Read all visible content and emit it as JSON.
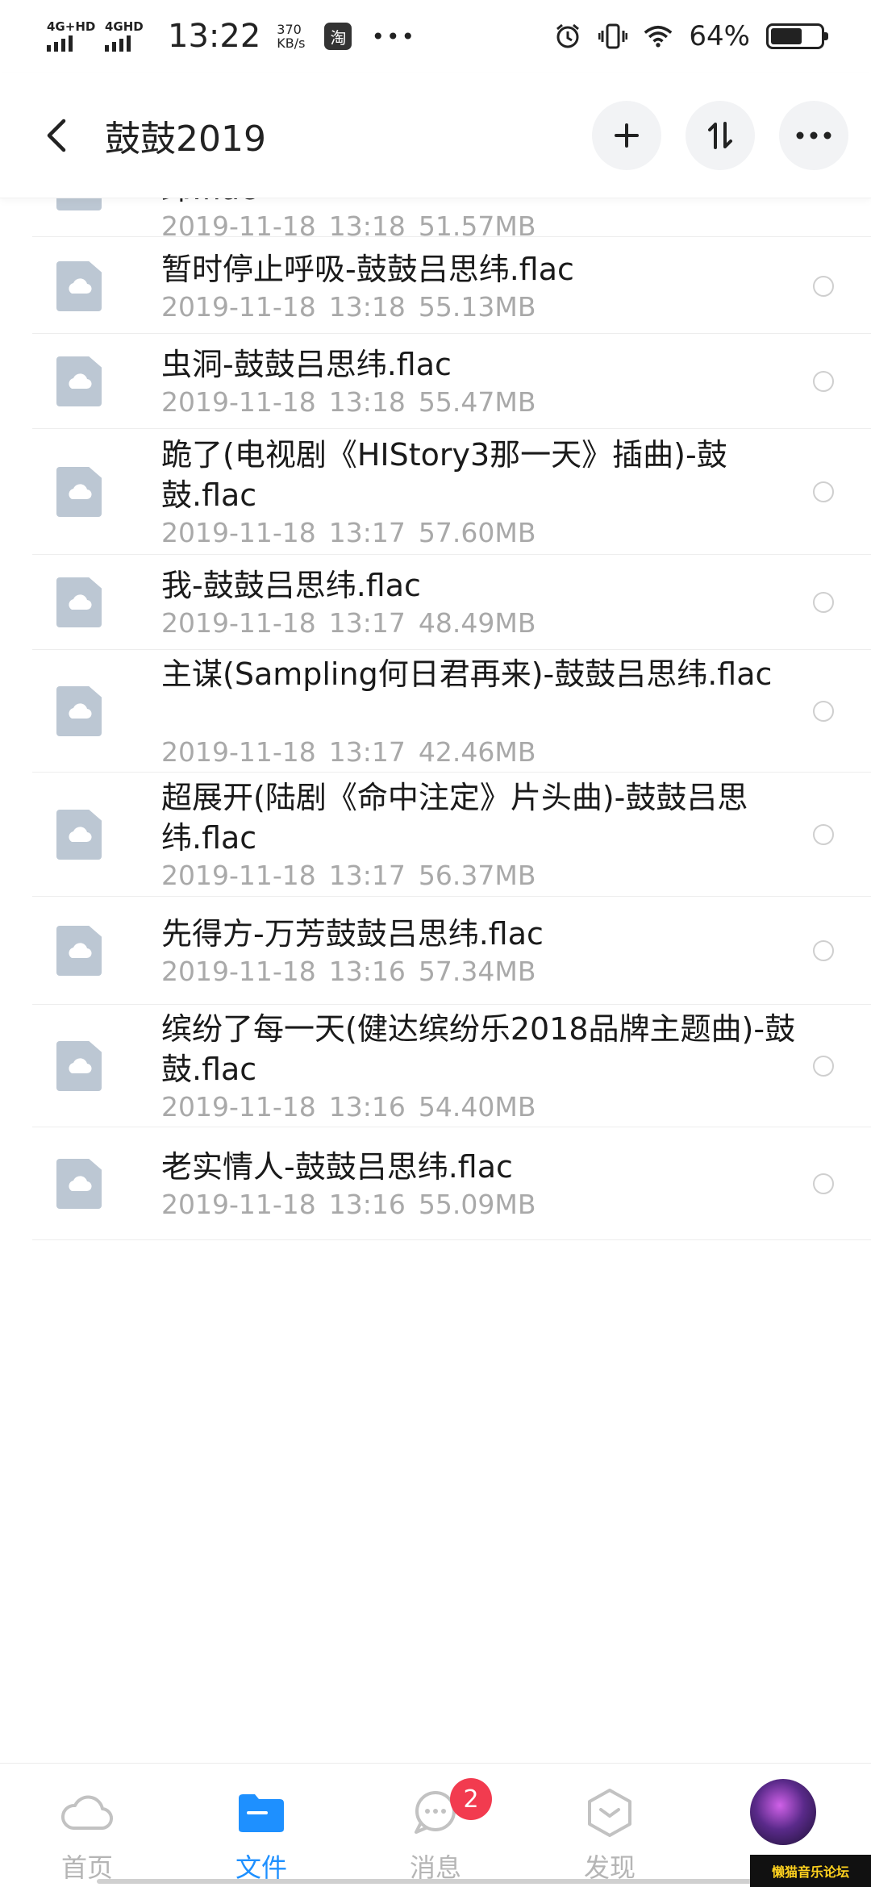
{
  "status_bar": {
    "net1": "4G+HD",
    "net2": "4GHD",
    "time": "13:22",
    "speed_value": "370",
    "speed_unit": "KB/s",
    "app_icon": "淘",
    "more": "•••",
    "battery_pct": "64%",
    "battery_level": 0.64
  },
  "header": {
    "title": "鼓鼓2019",
    "icons": [
      "back-icon",
      "plus-icon",
      "sort-icon",
      "more-icon"
    ]
  },
  "files": [
    {
      "name": "超机车节录：大埔国骂阿嬷-MATZKA鼓鼓吕思纬.flac",
      "date": "2019-11-18",
      "time": "13:18",
      "size": "51.57MB"
    },
    {
      "name": "暂时停止呼吸-鼓鼓吕思纬.flac",
      "date": "2019-11-18",
      "time": "13:18",
      "size": "55.13MB"
    },
    {
      "name": "虫洞-鼓鼓吕思纬.flac",
      "date": "2019-11-18",
      "time": "13:18",
      "size": "55.47MB"
    },
    {
      "name": "跪了(电视剧《HIStory3那一天》插曲)-鼓鼓.flac",
      "date": "2019-11-18",
      "time": "13:17",
      "size": "57.60MB"
    },
    {
      "name": "我-鼓鼓吕思纬.flac",
      "date": "2019-11-18",
      "time": "13:17",
      "size": "48.49MB"
    },
    {
      "name": "主谋(Sampling何日君再来)-鼓鼓吕思纬.flac",
      "date": "2019-11-18",
      "time": "13:17",
      "size": "42.46MB"
    },
    {
      "name": "超展开(陆剧《命中注定》片头曲)-鼓鼓吕思纬.flac",
      "date": "2019-11-18",
      "time": "13:17",
      "size": "56.37MB"
    },
    {
      "name": "先得方-万芳鼓鼓吕思纬.flac",
      "date": "2019-11-18",
      "time": "13:16",
      "size": "57.34MB"
    },
    {
      "name": "缤纷了每一天(健达缤纷乐2018品牌主题曲)-鼓鼓.flac",
      "date": "2019-11-18",
      "time": "13:16",
      "size": "54.40MB"
    },
    {
      "name": "老实情人-鼓鼓吕思纬.flac",
      "date": "2019-11-18",
      "time": "13:16",
      "size": "55.09MB"
    }
  ],
  "tabs": [
    {
      "label": "首页",
      "icon": "cloud-icon",
      "active": false
    },
    {
      "label": "文件",
      "icon": "folder-icon",
      "active": true
    },
    {
      "label": "消息",
      "icon": "chat-icon",
      "active": false,
      "badge": "2"
    },
    {
      "label": "发现",
      "icon": "discover-icon",
      "active": false
    }
  ],
  "watermark": "懒猫音乐论坛",
  "colors": {
    "accent": "#1e90ff",
    "badge": "#f23b4f",
    "file_icon": "#bcc7d3",
    "meta_text": "#a9a9a9"
  }
}
